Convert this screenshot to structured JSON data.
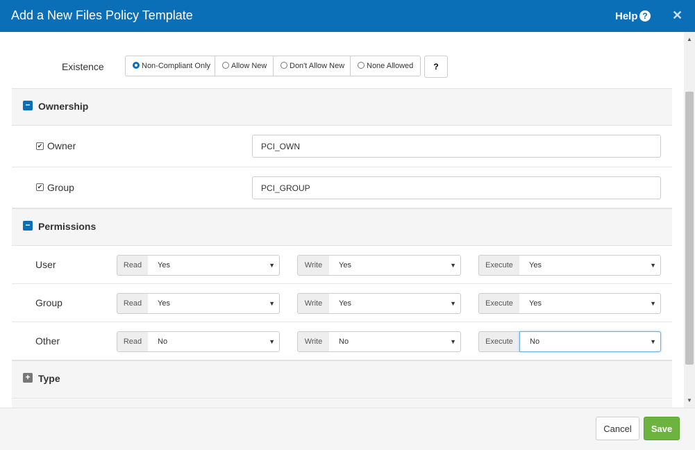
{
  "window": {
    "title": "Add a New Files Policy Template",
    "help_label": "Help",
    "help_icon": "question-circle-icon",
    "close_icon": "close-icon",
    "header_color": "#0b6fb8"
  },
  "existence": {
    "label": "Existence",
    "options": [
      "Non-Compliant Only",
      "Allow New",
      "Don't Allow New",
      "None Allowed"
    ],
    "selected": "Non-Compliant Only",
    "help_button": "?"
  },
  "ownership": {
    "title": "Ownership",
    "owner": {
      "label": "Owner",
      "checked": true,
      "value": "PCI_OWN"
    },
    "group": {
      "label": "Group",
      "checked": true,
      "value": "PCI_GROUP"
    }
  },
  "permissions": {
    "title": "Permissions",
    "read_label": "Read",
    "write_label": "Write",
    "execute_label": "Execute",
    "rows": [
      {
        "label": "User",
        "read": "Yes",
        "write": "Yes",
        "execute": "Yes"
      },
      {
        "label": "Group",
        "read": "Yes",
        "write": "Yes",
        "execute": "Yes"
      },
      {
        "label": "Other",
        "read": "No",
        "write": "No",
        "execute": "No"
      }
    ]
  },
  "type": {
    "title": "Type"
  },
  "footer": {
    "cancel_label": "Cancel",
    "save_label": "Save",
    "save_color": "#6cb33f"
  }
}
